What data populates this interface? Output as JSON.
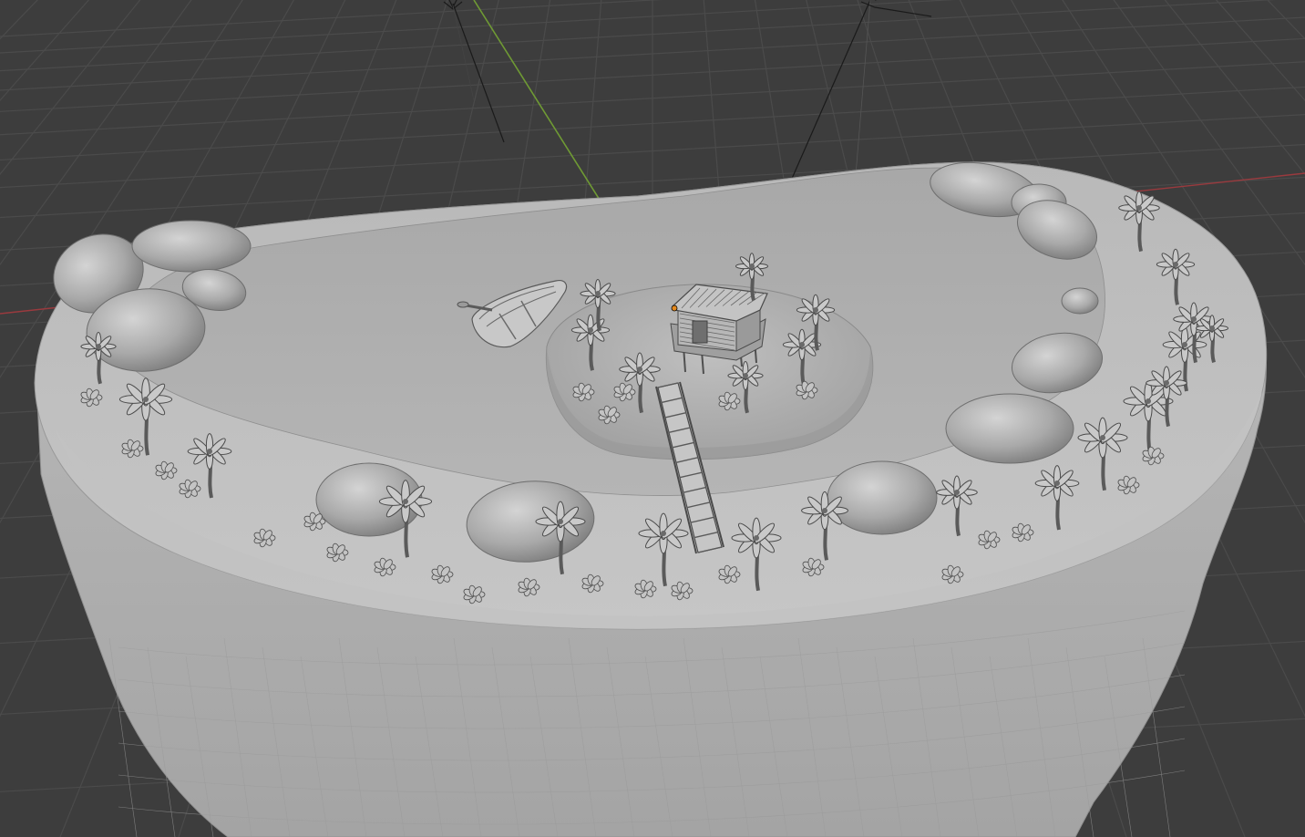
{
  "app": {
    "view": "3D viewport",
    "shading": "solid"
  },
  "colors": {
    "background": "#3d3d3d",
    "grid": "#4a4a4a",
    "axis_x": "#a8383e",
    "axis_y": "#6f9a34",
    "mesh": "#b3b3b3",
    "mesh_shadow": "#8c8c8c",
    "origin_dot": "#e68a1e"
  },
  "scene": {
    "objects": [
      {
        "name": "island-base",
        "icon": "mesh-icon"
      },
      {
        "name": "rowboat",
        "icon": "mesh-icon"
      },
      {
        "name": "stilt-hut",
        "icon": "mesh-icon"
      },
      {
        "name": "bridge",
        "icon": "mesh-icon"
      },
      {
        "name": "rocks",
        "icon": "mesh-icon"
      },
      {
        "name": "palm-trees",
        "icon": "mesh-icon"
      },
      {
        "name": "sun-light-left",
        "icon": "light-icon"
      },
      {
        "name": "sun-light-right",
        "icon": "light-icon"
      }
    ]
  }
}
